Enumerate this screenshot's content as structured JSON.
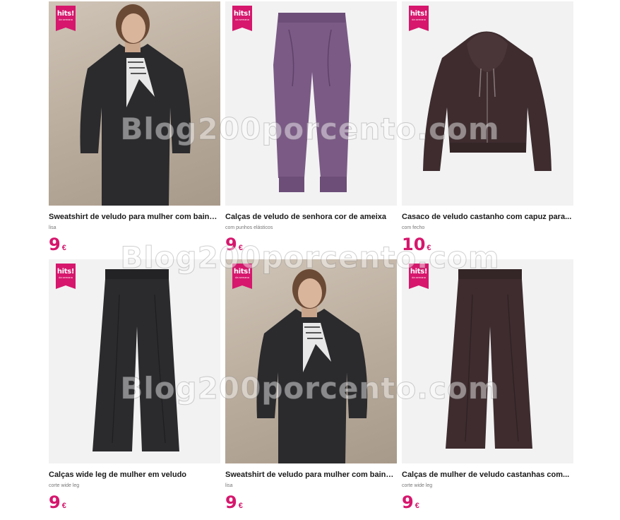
{
  "badge": {
    "main": "hits!",
    "sub": "da semana"
  },
  "watermark": "Blog200porcento.com",
  "products": [
    {
      "title": "Sweatshirt de veludo para mulher com bainha...",
      "subtitle": "lisa",
      "price": "9",
      "currency": "€"
    },
    {
      "title": "Calças de veludo de senhora cor de ameixa",
      "subtitle": "com punhos elásticos",
      "price": "9",
      "currency": "€"
    },
    {
      "title": "Casaco de veludo castanho com capuz para...",
      "subtitle": "com fecho",
      "price": "10",
      "currency": "€"
    },
    {
      "title": "Calças wide leg de mulher em veludo",
      "subtitle": "corte wide leg",
      "price": "9",
      "currency": "€"
    },
    {
      "title": "Sweatshirt de veludo para mulher com bainha...",
      "subtitle": "lisa",
      "price": "9",
      "currency": "€"
    },
    {
      "title": "Calças de mulher de veludo castanhas com...",
      "subtitle": "corte wide leg",
      "price": "9",
      "currency": "€"
    }
  ],
  "colors": {
    "accent": "#d6176d",
    "plum": "#7b5a86",
    "black_velvet": "#2b2b2e",
    "brown_velvet": "#3e2c2f"
  }
}
